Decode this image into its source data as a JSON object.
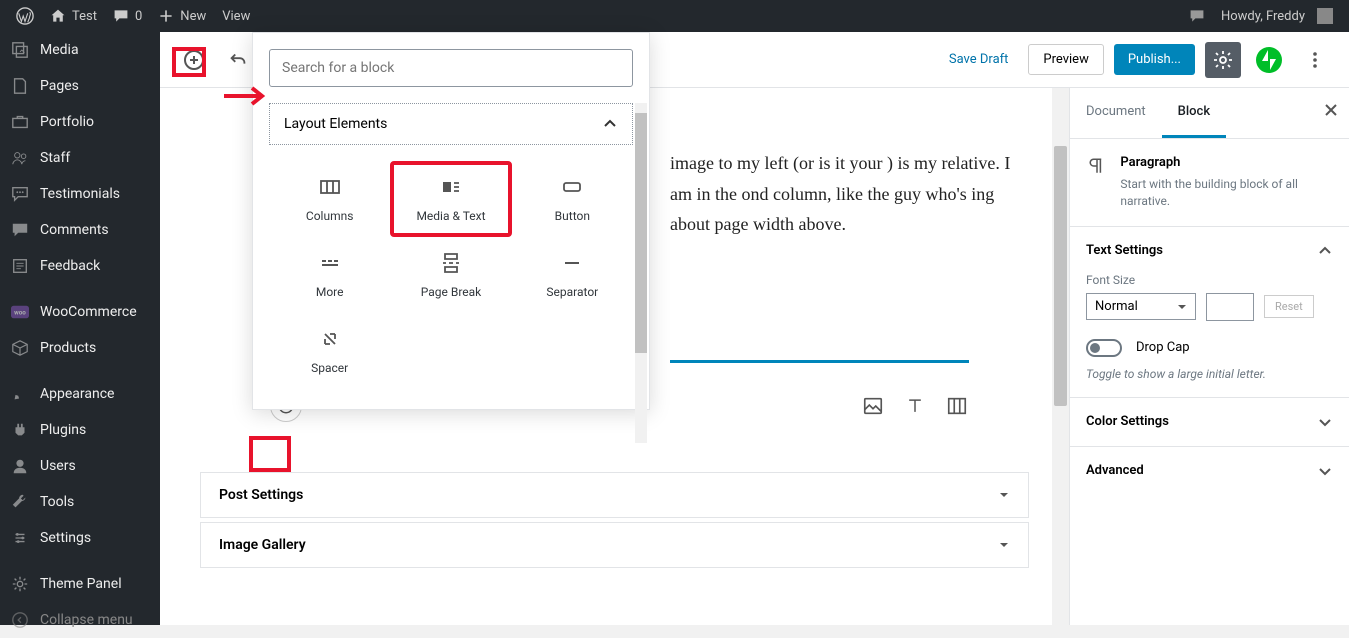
{
  "adminbar": {
    "site_title": "Test",
    "comments_count": "0",
    "new_label": "New",
    "view_label": "View",
    "howdy": "Howdy, Freddy"
  },
  "sidebar": {
    "items": [
      {
        "label": "Media",
        "icon": "media"
      },
      {
        "label": "Pages",
        "icon": "pages"
      },
      {
        "label": "Portfolio",
        "icon": "portfolio"
      },
      {
        "label": "Staff",
        "icon": "staff"
      },
      {
        "label": "Testimonials",
        "icon": "testimonials"
      },
      {
        "label": "Comments",
        "icon": "comments"
      },
      {
        "label": "Feedback",
        "icon": "feedback"
      },
      {
        "label": "WooCommerce",
        "icon": "woo"
      },
      {
        "label": "Products",
        "icon": "products"
      },
      {
        "label": "Appearance",
        "icon": "appearance"
      },
      {
        "label": "Plugins",
        "icon": "plugins"
      },
      {
        "label": "Users",
        "icon": "users"
      },
      {
        "label": "Tools",
        "icon": "tools"
      },
      {
        "label": "Settings",
        "icon": "settings"
      },
      {
        "label": "Theme Panel",
        "icon": "theme"
      },
      {
        "label": "Collapse menu",
        "icon": "collapse"
      }
    ]
  },
  "toolbar": {
    "save_draft": "Save Draft",
    "preview": "Preview",
    "publish": "Publish..."
  },
  "inserter": {
    "search_placeholder": "Search for a block",
    "category": "Layout Elements",
    "blocks": [
      {
        "label": "Columns",
        "icon": "columns"
      },
      {
        "label": "Media & Text",
        "icon": "mediatext"
      },
      {
        "label": "Button",
        "icon": "button"
      },
      {
        "label": "More",
        "icon": "more"
      },
      {
        "label": "Page Break",
        "icon": "pagebreak"
      },
      {
        "label": "Separator",
        "icon": "separator"
      },
      {
        "label": "Spacer",
        "icon": "spacer"
      }
    ]
  },
  "content": {
    "paragraph": "image to my left (or is it your ) is my relative. I am in the ond column, like the guy who's ing about page width above."
  },
  "meta_panels": [
    {
      "label": "Post Settings"
    },
    {
      "label": "Image Gallery"
    }
  ],
  "settings": {
    "tabs": {
      "document": "Document",
      "block": "Block"
    },
    "block_name": "Paragraph",
    "block_desc": "Start with the building block of all narrative.",
    "text_settings_header": "Text Settings",
    "font_size_label": "Font Size",
    "font_size_value": "Normal",
    "reset_label": "Reset",
    "drop_cap_label": "Drop Cap",
    "drop_cap_hint": "Toggle to show a large initial letter.",
    "color_header": "Color Settings",
    "advanced_header": "Advanced"
  }
}
